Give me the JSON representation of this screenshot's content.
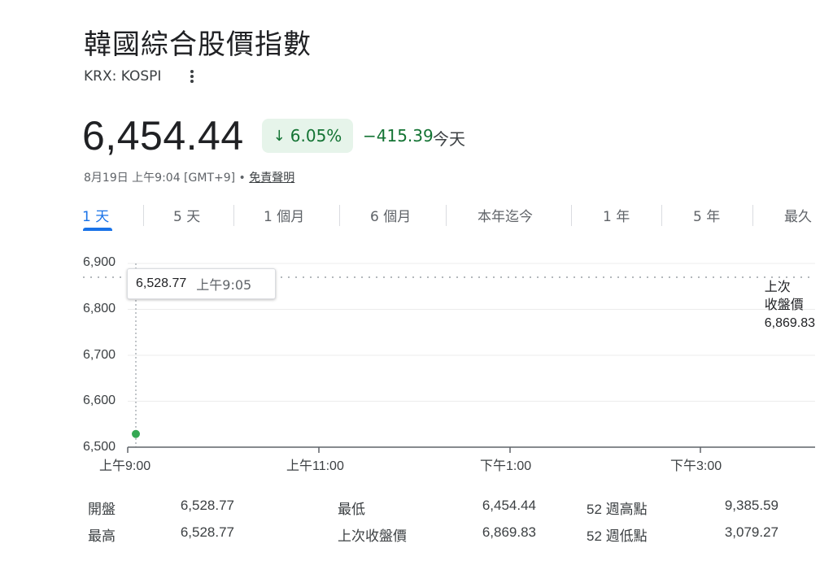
{
  "header": {
    "title": "韓國綜合股價指數",
    "ticker": "KRX: KOSPI"
  },
  "quote": {
    "price": "6,454.44",
    "pct_change": "6.05%",
    "abs_change": "−415.39",
    "period": "今天",
    "timestamp": "8月19日 上午9:04 [GMT+9] •",
    "disclaimer": "免責聲明",
    "change_color": "#137333"
  },
  "tabs": [
    {
      "label": "1 天",
      "active": true
    },
    {
      "label": "5 天"
    },
    {
      "label": "1 個月"
    },
    {
      "label": "6 個月"
    },
    {
      "label": "本年迄今"
    },
    {
      "label": "1 年"
    },
    {
      "label": "5 年"
    },
    {
      "label": "最久"
    }
  ],
  "tooltip": {
    "value": "6,528.77",
    "time": "上午9:05"
  },
  "previous_close_label_line1": "上次",
  "previous_close_label_line2": "收盤價",
  "previous_close_value": "6,869.83",
  "chart_data": {
    "type": "line",
    "ytick_labels": [
      "6,900",
      "6,800",
      "6,700",
      "6,600",
      "6,500"
    ],
    "yticks": [
      6900,
      6800,
      6700,
      6600,
      6500
    ],
    "ylim": [
      6500,
      6900
    ],
    "xtick_labels": [
      "上午9:00",
      "上午11:00",
      "下午1:00",
      "下午3:00"
    ],
    "series": [
      {
        "x": [
          "上午9:05"
        ],
        "values": [
          6528.77
        ],
        "color": "#34a853"
      }
    ],
    "reference_line": {
      "value": 6869.83
    },
    "grid": true
  },
  "stats": {
    "rows": [
      [
        {
          "label": "開盤",
          "value": "6,528.77"
        },
        {
          "label": "最低",
          "value": "6,454.44"
        },
        {
          "label": "52 週高點",
          "value": "9,385.59"
        }
      ],
      [
        {
          "label": "最高",
          "value": "6,528.77"
        },
        {
          "label": "上次收盤價",
          "value": "6,869.83"
        },
        {
          "label": "52 週低點",
          "value": "3,079.27"
        }
      ]
    ]
  }
}
